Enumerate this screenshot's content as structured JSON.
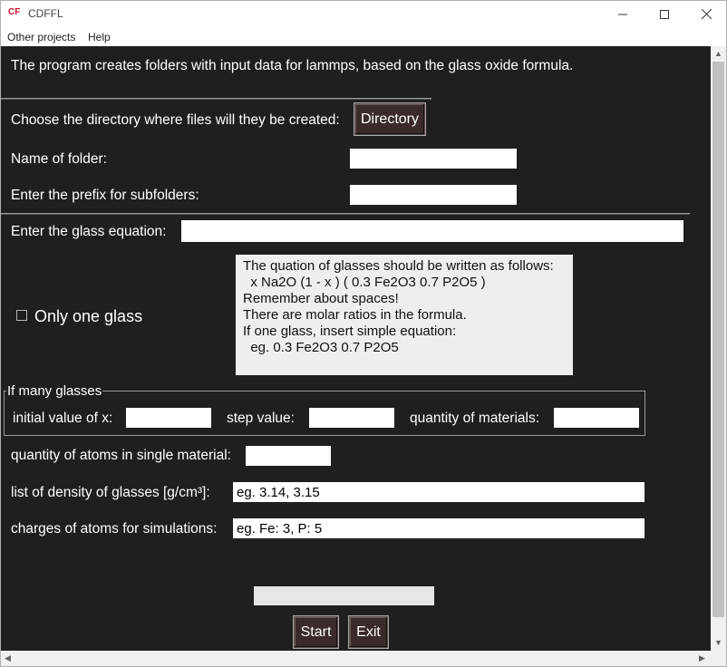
{
  "window": {
    "logo_text": "CF",
    "title": "CDFFL",
    "minimize_glyph": "—",
    "maximize_glyph": "☐",
    "close_glyph": "✕"
  },
  "menu": {
    "items": [
      "Other projects",
      "Help"
    ]
  },
  "main": {
    "intro": "The program creates folders with input data for lammps, based on the glass oxide formula.",
    "directory_label": "Choose the directory where files will they be created:",
    "directory_button": "Directory",
    "folder_name_label": "Name of folder:",
    "folder_name_value": "",
    "prefix_label": "Enter the prefix for subfolders:",
    "prefix_value": "",
    "equation_label": "Enter the glass equation:",
    "equation_value": "",
    "only_one_glass_label": "Only one glass",
    "only_one_glass_checked": false,
    "info_lines": [
      "The quation of glasses should be written as follows:",
      "  x Na2O (1 - x ) ( 0.3 Fe2O3 0.7 P2O5 )",
      "",
      "Remember about spaces!",
      "There are molar ratios in the formula.",
      "If one glass, insert simple equation:",
      "  eg. 0.3 Fe2O3 0.7 P2O5"
    ]
  },
  "many_glasses": {
    "group_label": "If many glasses",
    "initial_x_label": "initial value of x:",
    "initial_x_value": "",
    "step_label": "step value:",
    "step_value": "",
    "quantity_label": "quantity of materials:",
    "quantity_value": ""
  },
  "atoms": {
    "atoms_label": "quantity of atoms in single material:",
    "atoms_value": "",
    "density_label": "list of density of glasses [g/cm³]:",
    "density_value": "eg. 3.14, 3.15",
    "charges_label": "charges of atoms for simulations:",
    "charges_value": "eg. Fe: 3, P: 5"
  },
  "actions": {
    "progress": 0,
    "start_button": "Start",
    "exit_button": "Exit"
  },
  "scrollbar_arrows": {
    "up": "▲",
    "down": "▼",
    "left": "◀",
    "right": "▶"
  },
  "colors": {
    "background": "#1f1f1f",
    "button": "#3a2a29",
    "logo": "#c8102e"
  }
}
